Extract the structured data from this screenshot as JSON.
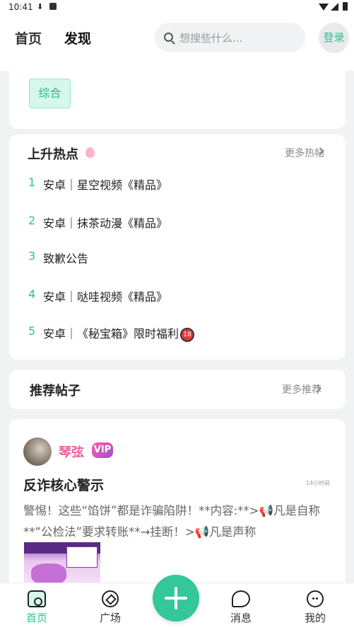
{
  "status_bar": {
    "time": "10:41"
  },
  "header": {
    "tabs": [
      {
        "label": "首页",
        "active": false
      },
      {
        "label": "发现",
        "active": true
      }
    ],
    "search_placeholder": "想搜些什么...",
    "login_label": "登录"
  },
  "category_chip": "综合",
  "hot": {
    "title": "上升热点",
    "more_label": "更多热帖",
    "items": [
      {
        "rank": "1",
        "text": "安卓｜星空视频《精品》"
      },
      {
        "rank": "2",
        "text": "安卓｜抹茶动漫《精品》"
      },
      {
        "rank": "3",
        "text": "致歉公告"
      },
      {
        "rank": "4",
        "text": "安卓｜哒哇视频《精品》"
      },
      {
        "rank": "5",
        "text": "安卓｜《秘宝箱》限时福利"
      }
    ],
    "badge_18": "18"
  },
  "recommend": {
    "title": "推荐帖子",
    "more_label": "更多推荐"
  },
  "post": {
    "username": "琴弦",
    "vip_label": "VIP",
    "title": "反诈核心警示",
    "time": "14小时前",
    "excerpt": "警惕！这些“馅饼”都是诈骗陷阱！**内容:**>📢凡是自称**“公检法”要求转账**→挂断！>📢凡是声称"
  },
  "bottom_nav": {
    "items": [
      {
        "label": "首页",
        "icon": "home-icon",
        "active": true
      },
      {
        "label": "广场",
        "icon": "compass-icon",
        "active": false
      },
      {
        "label": "消息",
        "icon": "message-icon",
        "active": false
      },
      {
        "label": "我的",
        "icon": "profile-icon",
        "active": false
      }
    ]
  },
  "colors": {
    "accent": "#2ebf93",
    "vip_pink": "#f05f9d",
    "background": "#f1f2f4"
  }
}
